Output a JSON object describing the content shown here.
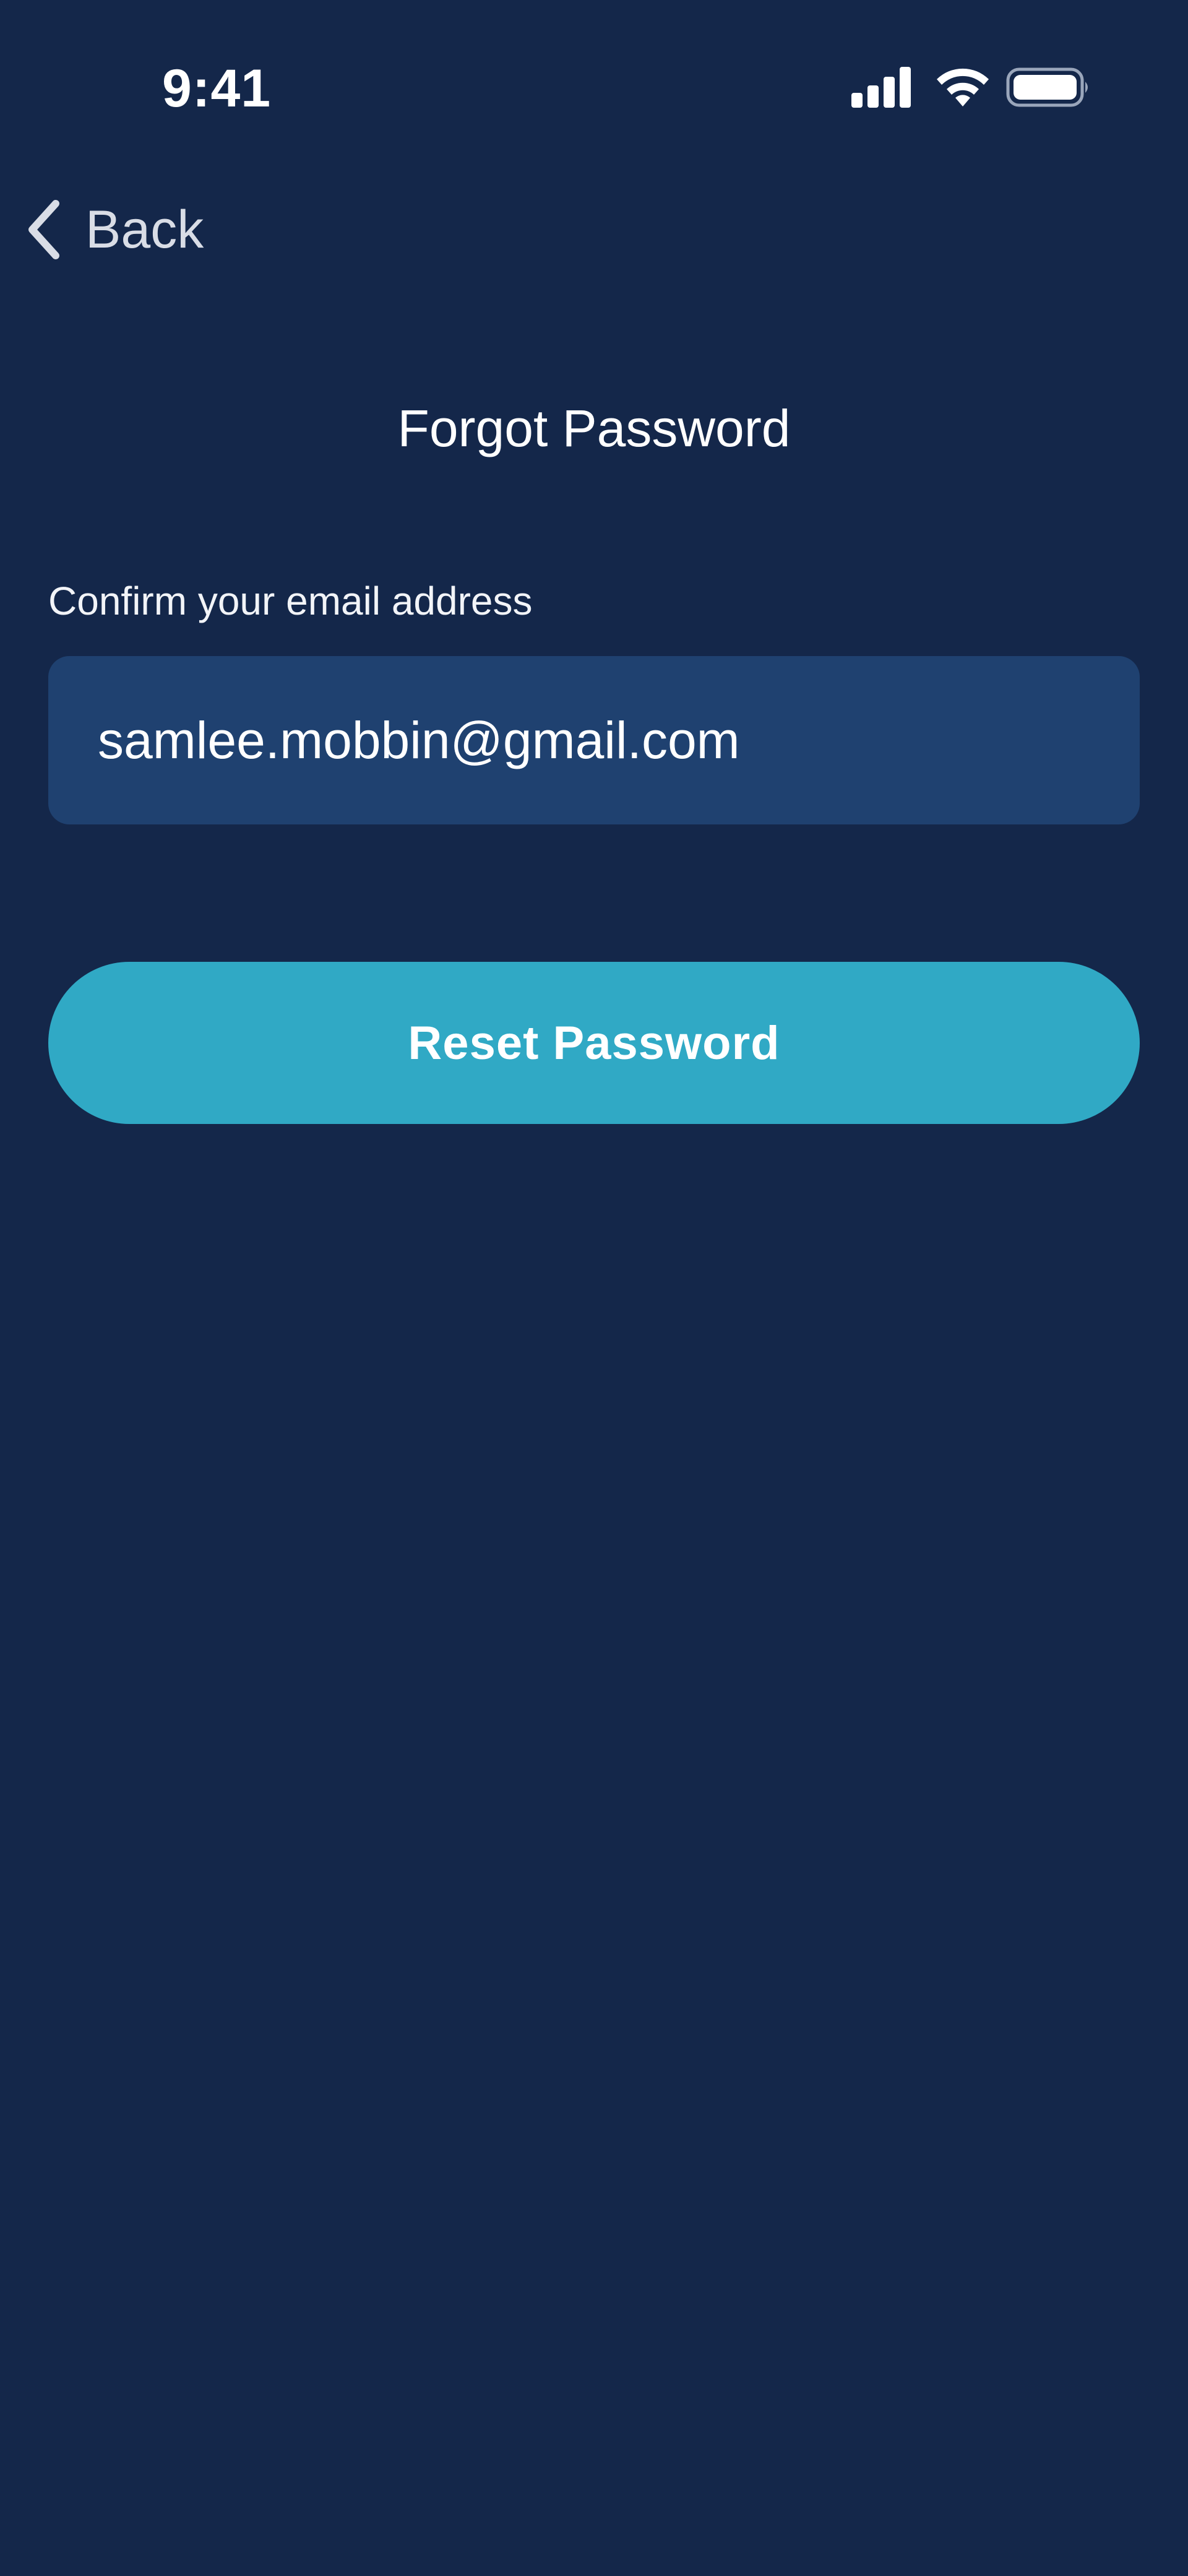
{
  "status_bar": {
    "time": "9:41",
    "icons": [
      "cellular-signal-icon",
      "wifi-icon",
      "battery-icon"
    ]
  },
  "nav": {
    "back_label": "Back",
    "back_icon": "chevron-left-icon"
  },
  "page": {
    "title": "Forgot Password"
  },
  "form": {
    "email_label": "Confirm your email address",
    "email_value": "samlee.mobbin@gmail.com",
    "submit_label": "Reset Password"
  },
  "colors": {
    "background": "#14274a",
    "input_background": "#1f4170",
    "button_background": "#30a9c5",
    "text": "#ffffff"
  }
}
